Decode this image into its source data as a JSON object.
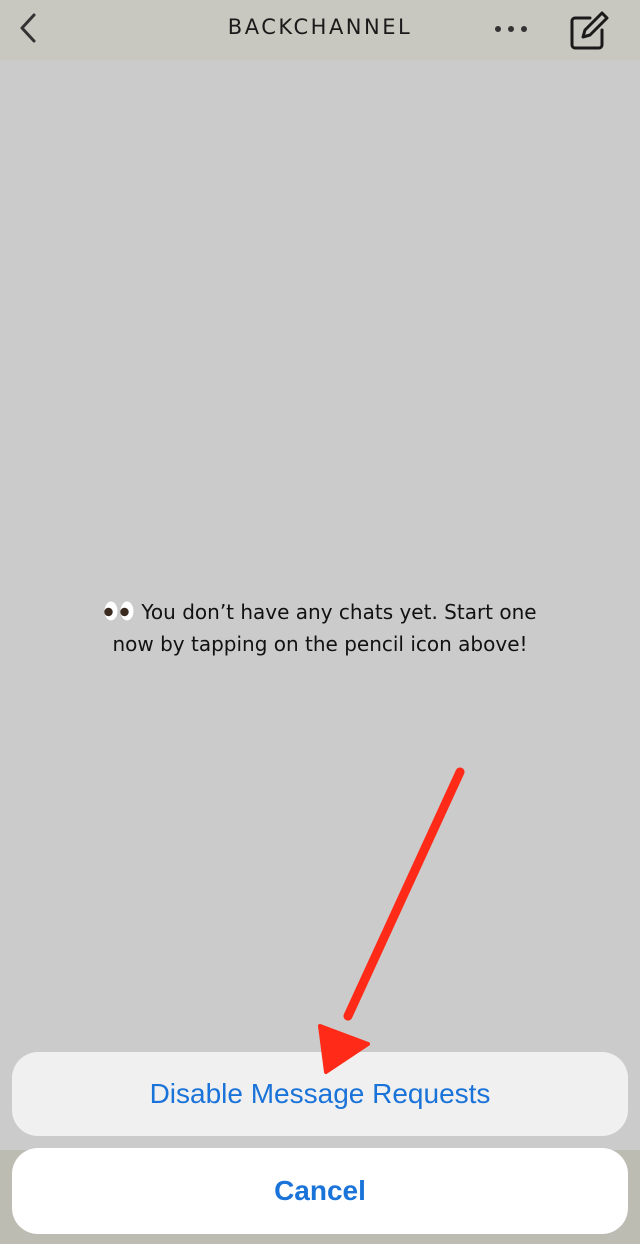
{
  "header": {
    "title": "BACKCHANNEL",
    "back_icon": "chevron-left-icon",
    "more_icon": "ellipsis-icon",
    "compose_icon": "compose-icon"
  },
  "empty_state": {
    "icon": "eyes-icon",
    "message": "You don’t have any chats yet. Start one now by tapping on the pencil icon above!"
  },
  "action_sheet": {
    "option_label": "Disable Message Requests",
    "cancel_label": "Cancel"
  },
  "annotation": {
    "icon": "red-arrow-icon",
    "color": "#ff2a17"
  },
  "colors": {
    "accent": "#1a73d8",
    "header_bg": "#c9c8c0",
    "content_bg": "#cbcbcb"
  }
}
